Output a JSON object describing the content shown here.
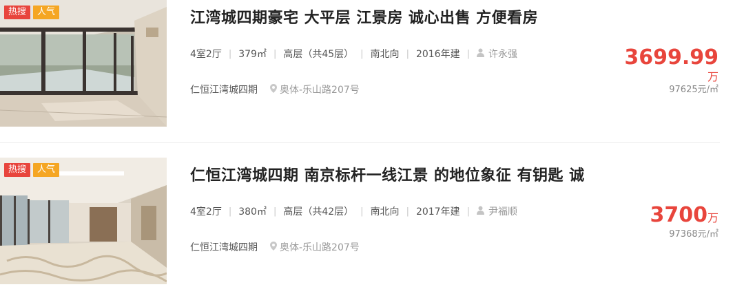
{
  "listings": [
    {
      "tags": [
        "热搜",
        "人气"
      ],
      "title": "江湾城四期豪宅 大平层 江景房 诚心出售 方便看房",
      "layout": "4室2厅",
      "area": "379㎡",
      "floor": "高层（共45层）",
      "orientation": "南北向",
      "year": "2016年建",
      "agent": "许永强",
      "community": "仁恒江湾城四期",
      "address": "奥体-乐山路207号",
      "price": "3699.99",
      "price_unit": "万",
      "unit_price": "97625元/㎡"
    },
    {
      "tags": [
        "热搜",
        "人气"
      ],
      "title": "仁恒江湾城四期 南京标杆一线江景 的地位象征 有钥匙 诚",
      "layout": "4室2厅",
      "area": "380㎡",
      "floor": "高层（共42层）",
      "orientation": "南北向",
      "year": "2017年建",
      "agent": "尹福顺",
      "community": "仁恒江湾城四期",
      "address": "奥体-乐山路207号",
      "price": "3700",
      "price_unit": "万",
      "unit_price": "97368元/㎡"
    }
  ],
  "icons": {
    "agent": "person-icon",
    "location": "location-pin-icon"
  },
  "colors": {
    "accent": "#e8453c",
    "tag_hot": "#e8453c",
    "tag_popular": "#f5a623"
  }
}
